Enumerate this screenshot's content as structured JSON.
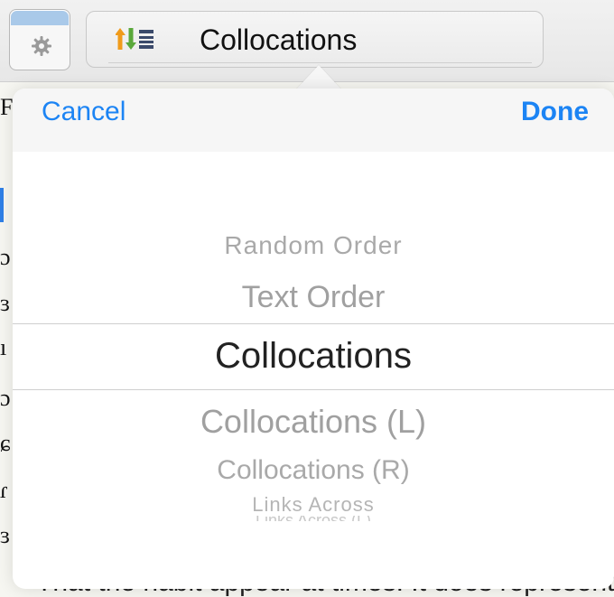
{
  "toolbar": {
    "sort_selector_label": "Collocations"
  },
  "popover": {
    "cancel_label": "Cancel",
    "done_label": "Done",
    "picker": {
      "selected_index": 2,
      "items": [
        "Random Order",
        "Text Order",
        "Collocations",
        "Collocations (L)",
        "Collocations (R)",
        "Links Across",
        "Links Across (L)"
      ]
    }
  },
  "background": {
    "bottom_text": "That the habit appear at times. It does represent"
  },
  "colors": {
    "accent": "#1c84f4",
    "settings_header": "#a9c9e9",
    "picker_text": "#9a9a9a",
    "selected_text": "#222222"
  }
}
